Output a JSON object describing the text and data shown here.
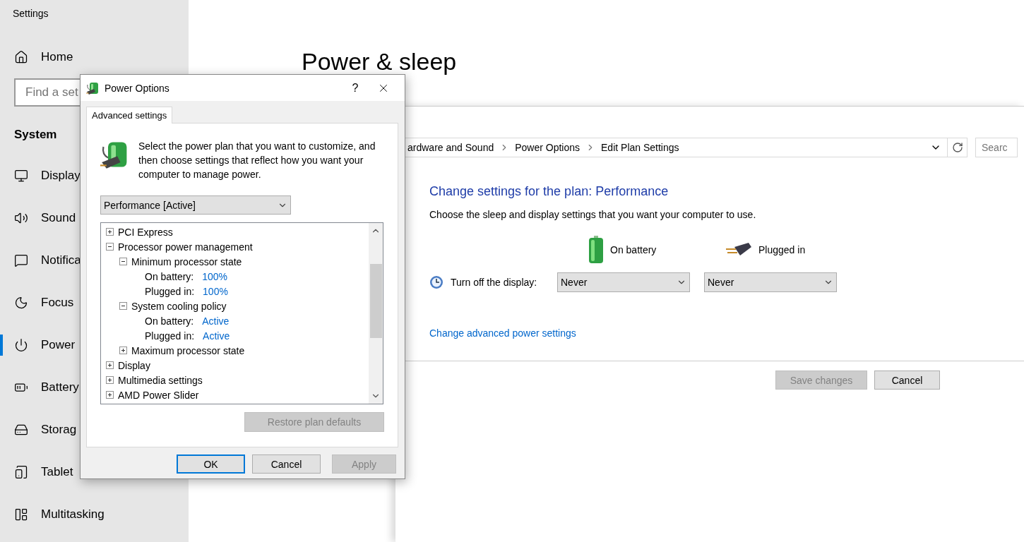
{
  "settings": {
    "title": "Settings",
    "home": "Home",
    "search": {
      "placeholder": "Find a set"
    },
    "section": "System",
    "nav": [
      {
        "label": "Display",
        "selected": false
      },
      {
        "label": "Sound",
        "selected": false
      },
      {
        "label": "Notifica",
        "selected": false
      },
      {
        "label": "Focus",
        "selected": false
      },
      {
        "label": "Power",
        "selected": true
      },
      {
        "label": "Battery",
        "selected": false
      },
      {
        "label": "Storag",
        "selected": false
      },
      {
        "label": "Tablet",
        "selected": false
      },
      {
        "label": "Multitasking",
        "selected": false
      }
    ],
    "page_title": "Power & sleep"
  },
  "control_panel": {
    "breadcrumb": [
      "ardware and Sound",
      "Power Options",
      "Edit Plan Settings"
    ],
    "search": {
      "placeholder": "Searc"
    },
    "title": "Change settings for the plan: Performance",
    "description": "Choose the sleep and display settings that you want your computer to use.",
    "columns": [
      {
        "kind": "battery",
        "label": "On battery"
      },
      {
        "kind": "plug",
        "label": "Plugged in"
      }
    ],
    "settings": [
      {
        "label": "Turn off the display:",
        "values": [
          "Never",
          "Never"
        ]
      }
    ],
    "link": "Change advanced power settings",
    "buttons": [
      {
        "label": "Save changes",
        "disabled": true
      },
      {
        "label": "Cancel",
        "disabled": false
      }
    ]
  },
  "dialog": {
    "title": "Power Options",
    "help": "?",
    "tabs": [
      {
        "label": "Advanced settings",
        "selected": true
      }
    ],
    "intro": "Select the power plan that you want to customize, and then choose settings that reflect how you want your computer to manage power.",
    "plan": "Performance [Active]",
    "tree": [
      {
        "kind": "group",
        "label": "PCI Express",
        "expanded": false
      },
      {
        "kind": "group",
        "label": "Processor power management",
        "expanded": true,
        "children": [
          {
            "kind": "group",
            "label": "Minimum processor state",
            "expanded": true,
            "children": [
              {
                "kind": "value",
                "label": "On battery:",
                "value": "100%"
              },
              {
                "kind": "value",
                "label": "Plugged in:",
                "value": "100%"
              }
            ]
          },
          {
            "kind": "group",
            "label": "System cooling policy",
            "expanded": true,
            "children": [
              {
                "kind": "value",
                "label": "On battery:",
                "value": "Active"
              },
              {
                "kind": "value",
                "label": "Plugged in:",
                "value": "Active"
              }
            ]
          },
          {
            "kind": "group",
            "label": "Maximum processor state",
            "expanded": false
          }
        ]
      },
      {
        "kind": "group",
        "label": "Display",
        "expanded": false
      },
      {
        "kind": "group",
        "label": "Multimedia settings",
        "expanded": false
      },
      {
        "kind": "group",
        "label": "AMD Power Slider",
        "expanded": false
      }
    ],
    "restore": {
      "label": "Restore plan defaults",
      "disabled": true
    },
    "buttons": [
      {
        "label": "OK",
        "default": true,
        "disabled": false
      },
      {
        "label": "Cancel",
        "default": false,
        "disabled": false
      },
      {
        "label": "Apply",
        "default": false,
        "disabled": true
      }
    ]
  }
}
